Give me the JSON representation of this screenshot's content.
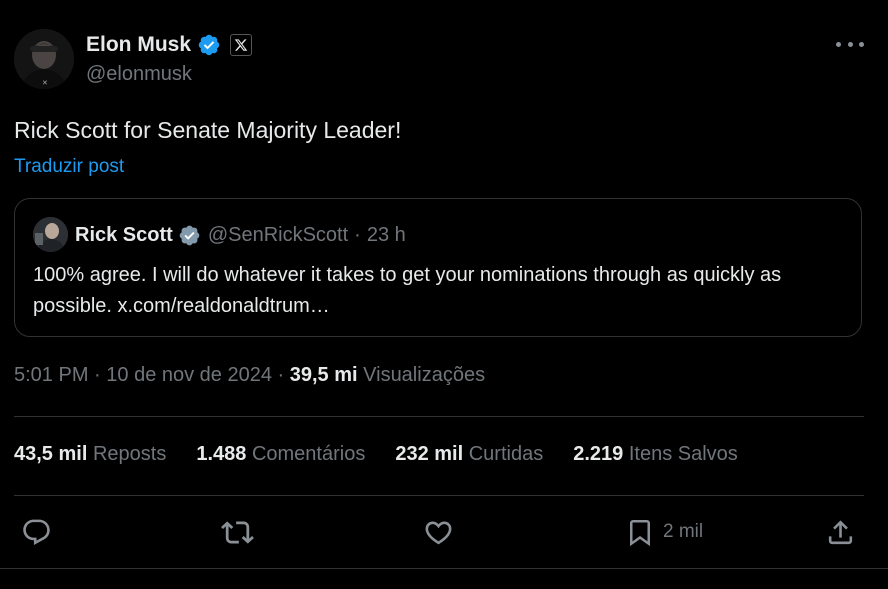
{
  "author": {
    "name": "Elon Musk",
    "handle": "@elonmusk"
  },
  "post": {
    "text": "Rick Scott for Senate Majority Leader!",
    "translate_label": "Traduzir post"
  },
  "quote": {
    "name": "Rick Scott",
    "handle": "@SenRickScott",
    "separator": "·",
    "time": "23 h",
    "text": "100% agree. I will do whatever it takes to get your nominations through as quickly as possible. x.com/realdonaldtrum…"
  },
  "meta": {
    "time": "5:01 PM",
    "sep1": " · ",
    "date": "10 de nov de 2024",
    "sep2": " · ",
    "views_count": "39,5 mi",
    "views_label": "Visualizações"
  },
  "stats": [
    {
      "num": "43,5 mil",
      "label": "Reposts"
    },
    {
      "num": "1.488",
      "label": "Comentários"
    },
    {
      "num": "232 mil",
      "label": "Curtidas"
    },
    {
      "num": "2.219",
      "label": "Itens Salvos"
    }
  ],
  "actions": {
    "reply_icon": "reply-icon",
    "retweet_icon": "retweet-icon",
    "like_icon": "heart-icon",
    "bookmark_icon": "bookmark-icon",
    "bookmark_count": "2 mil",
    "share_icon": "share-icon"
  },
  "colors": {
    "background": "#000000",
    "text": "#e7e9ea",
    "secondary": "#71767b",
    "accent": "#1d9bf0",
    "border": "#2f3336"
  }
}
